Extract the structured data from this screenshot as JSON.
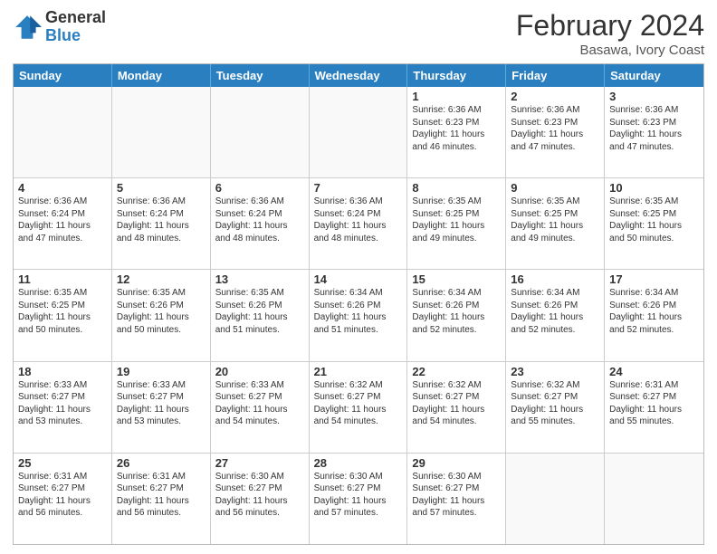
{
  "logo": {
    "general": "General",
    "blue": "Blue"
  },
  "header": {
    "month_year": "February 2024",
    "location": "Basawa, Ivory Coast"
  },
  "weekdays": [
    "Sunday",
    "Monday",
    "Tuesday",
    "Wednesday",
    "Thursday",
    "Friday",
    "Saturday"
  ],
  "rows": [
    [
      {
        "day": "",
        "text": ""
      },
      {
        "day": "",
        "text": ""
      },
      {
        "day": "",
        "text": ""
      },
      {
        "day": "",
        "text": ""
      },
      {
        "day": "1",
        "text": "Sunrise: 6:36 AM\nSunset: 6:23 PM\nDaylight: 11 hours\nand 46 minutes."
      },
      {
        "day": "2",
        "text": "Sunrise: 6:36 AM\nSunset: 6:23 PM\nDaylight: 11 hours\nand 47 minutes."
      },
      {
        "day": "3",
        "text": "Sunrise: 6:36 AM\nSunset: 6:23 PM\nDaylight: 11 hours\nand 47 minutes."
      }
    ],
    [
      {
        "day": "4",
        "text": "Sunrise: 6:36 AM\nSunset: 6:24 PM\nDaylight: 11 hours\nand 47 minutes."
      },
      {
        "day": "5",
        "text": "Sunrise: 6:36 AM\nSunset: 6:24 PM\nDaylight: 11 hours\nand 48 minutes."
      },
      {
        "day": "6",
        "text": "Sunrise: 6:36 AM\nSunset: 6:24 PM\nDaylight: 11 hours\nand 48 minutes."
      },
      {
        "day": "7",
        "text": "Sunrise: 6:36 AM\nSunset: 6:24 PM\nDaylight: 11 hours\nand 48 minutes."
      },
      {
        "day": "8",
        "text": "Sunrise: 6:35 AM\nSunset: 6:25 PM\nDaylight: 11 hours\nand 49 minutes."
      },
      {
        "day": "9",
        "text": "Sunrise: 6:35 AM\nSunset: 6:25 PM\nDaylight: 11 hours\nand 49 minutes."
      },
      {
        "day": "10",
        "text": "Sunrise: 6:35 AM\nSunset: 6:25 PM\nDaylight: 11 hours\nand 50 minutes."
      }
    ],
    [
      {
        "day": "11",
        "text": "Sunrise: 6:35 AM\nSunset: 6:25 PM\nDaylight: 11 hours\nand 50 minutes."
      },
      {
        "day": "12",
        "text": "Sunrise: 6:35 AM\nSunset: 6:26 PM\nDaylight: 11 hours\nand 50 minutes."
      },
      {
        "day": "13",
        "text": "Sunrise: 6:35 AM\nSunset: 6:26 PM\nDaylight: 11 hours\nand 51 minutes."
      },
      {
        "day": "14",
        "text": "Sunrise: 6:34 AM\nSunset: 6:26 PM\nDaylight: 11 hours\nand 51 minutes."
      },
      {
        "day": "15",
        "text": "Sunrise: 6:34 AM\nSunset: 6:26 PM\nDaylight: 11 hours\nand 52 minutes."
      },
      {
        "day": "16",
        "text": "Sunrise: 6:34 AM\nSunset: 6:26 PM\nDaylight: 11 hours\nand 52 minutes."
      },
      {
        "day": "17",
        "text": "Sunrise: 6:34 AM\nSunset: 6:26 PM\nDaylight: 11 hours\nand 52 minutes."
      }
    ],
    [
      {
        "day": "18",
        "text": "Sunrise: 6:33 AM\nSunset: 6:27 PM\nDaylight: 11 hours\nand 53 minutes."
      },
      {
        "day": "19",
        "text": "Sunrise: 6:33 AM\nSunset: 6:27 PM\nDaylight: 11 hours\nand 53 minutes."
      },
      {
        "day": "20",
        "text": "Sunrise: 6:33 AM\nSunset: 6:27 PM\nDaylight: 11 hours\nand 54 minutes."
      },
      {
        "day": "21",
        "text": "Sunrise: 6:32 AM\nSunset: 6:27 PM\nDaylight: 11 hours\nand 54 minutes."
      },
      {
        "day": "22",
        "text": "Sunrise: 6:32 AM\nSunset: 6:27 PM\nDaylight: 11 hours\nand 54 minutes."
      },
      {
        "day": "23",
        "text": "Sunrise: 6:32 AM\nSunset: 6:27 PM\nDaylight: 11 hours\nand 55 minutes."
      },
      {
        "day": "24",
        "text": "Sunrise: 6:31 AM\nSunset: 6:27 PM\nDaylight: 11 hours\nand 55 minutes."
      }
    ],
    [
      {
        "day": "25",
        "text": "Sunrise: 6:31 AM\nSunset: 6:27 PM\nDaylight: 11 hours\nand 56 minutes."
      },
      {
        "day": "26",
        "text": "Sunrise: 6:31 AM\nSunset: 6:27 PM\nDaylight: 11 hours\nand 56 minutes."
      },
      {
        "day": "27",
        "text": "Sunrise: 6:30 AM\nSunset: 6:27 PM\nDaylight: 11 hours\nand 56 minutes."
      },
      {
        "day": "28",
        "text": "Sunrise: 6:30 AM\nSunset: 6:27 PM\nDaylight: 11 hours\nand 57 minutes."
      },
      {
        "day": "29",
        "text": "Sunrise: 6:30 AM\nSunset: 6:27 PM\nDaylight: 11 hours\nand 57 minutes."
      },
      {
        "day": "",
        "text": ""
      },
      {
        "day": "",
        "text": ""
      }
    ]
  ]
}
